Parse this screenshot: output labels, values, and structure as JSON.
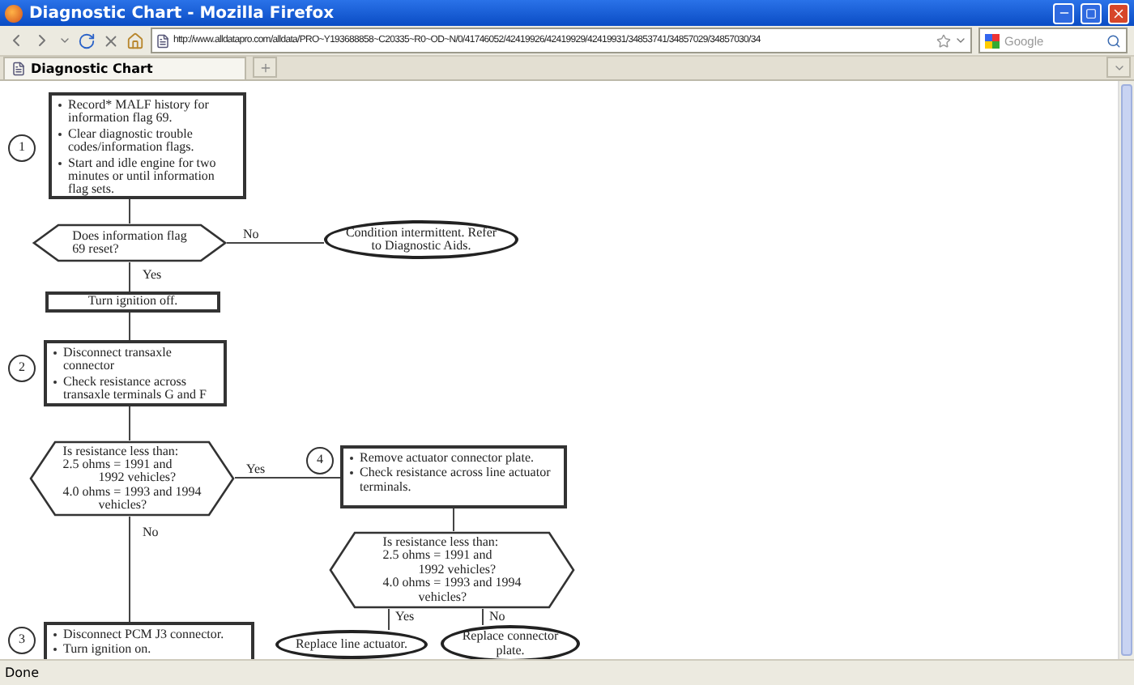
{
  "window": {
    "title": "Diagnostic Chart - Mozilla Firefox"
  },
  "toolbar": {
    "url": "http://www.alldatapro.com/alldata/PRO~Y193688858~C20335~R0~OD~N/0/41746052/42419926/42419929/42419931/34853741/34857029/34857030/34",
    "search": {
      "placeholder": "Google"
    }
  },
  "tabs": [
    {
      "label": "Diagnostic Chart",
      "selected": true
    }
  ],
  "flowchart": {
    "nodes": [
      {
        "kind": "marker",
        "text": "1"
      },
      {
        "kind": "step",
        "bullets": [
          "Record* MALF history for information flag 69.",
          "Clear diagnostic trouble codes/information flags.",
          "Start and idle engine for two minutes or until information flag  sets."
        ]
      },
      {
        "kind": "decision",
        "lines": [
          "Does information flag",
          "69 reset?"
        ]
      },
      {
        "kind": "end",
        "text": "Condition intermittent. Refer to Diagnostic Aids."
      },
      {
        "kind": "action",
        "text": "Turn ignition off."
      },
      {
        "kind": "marker",
        "text": "2"
      },
      {
        "kind": "step",
        "bullets": [
          "Disconnect transaxle connector",
          "Check resistance across transaxle terminals G and F"
        ]
      },
      {
        "kind": "decision",
        "lines": [
          "Is resistance less  than:",
          "2.5 ohms = 1991 and",
          "1992 vehicles?",
          "4.0 ohms = 1993 and 1994",
          "vehicles?"
        ]
      },
      {
        "kind": "marker",
        "text": "4"
      },
      {
        "kind": "step",
        "bullets": [
          "Remove actuator connector plate.",
          "Check resistance across line actuator terminals."
        ]
      },
      {
        "kind": "decision",
        "lines": [
          "Is resistance less than:",
          "2.5 ohms = 1991 and",
          "1992 vehicles?",
          "4.0 ohms = 1993 and 1994",
          "vehicles?"
        ]
      },
      {
        "kind": "marker",
        "text": "3"
      },
      {
        "kind": "step",
        "bullets": [
          "Disconnect PCM J3 connector.",
          "Turn ignition on."
        ]
      },
      {
        "kind": "end",
        "text": "Replace line actuator."
      },
      {
        "kind": "end",
        "text": "Replace connector plate."
      }
    ],
    "connectors": [
      {
        "label": "No"
      },
      {
        "label": "Yes"
      },
      {
        "label": "Yes"
      },
      {
        "label": "No"
      },
      {
        "label": "Yes"
      },
      {
        "label": "No"
      }
    ]
  },
  "status_bar": {
    "text": "Done"
  }
}
